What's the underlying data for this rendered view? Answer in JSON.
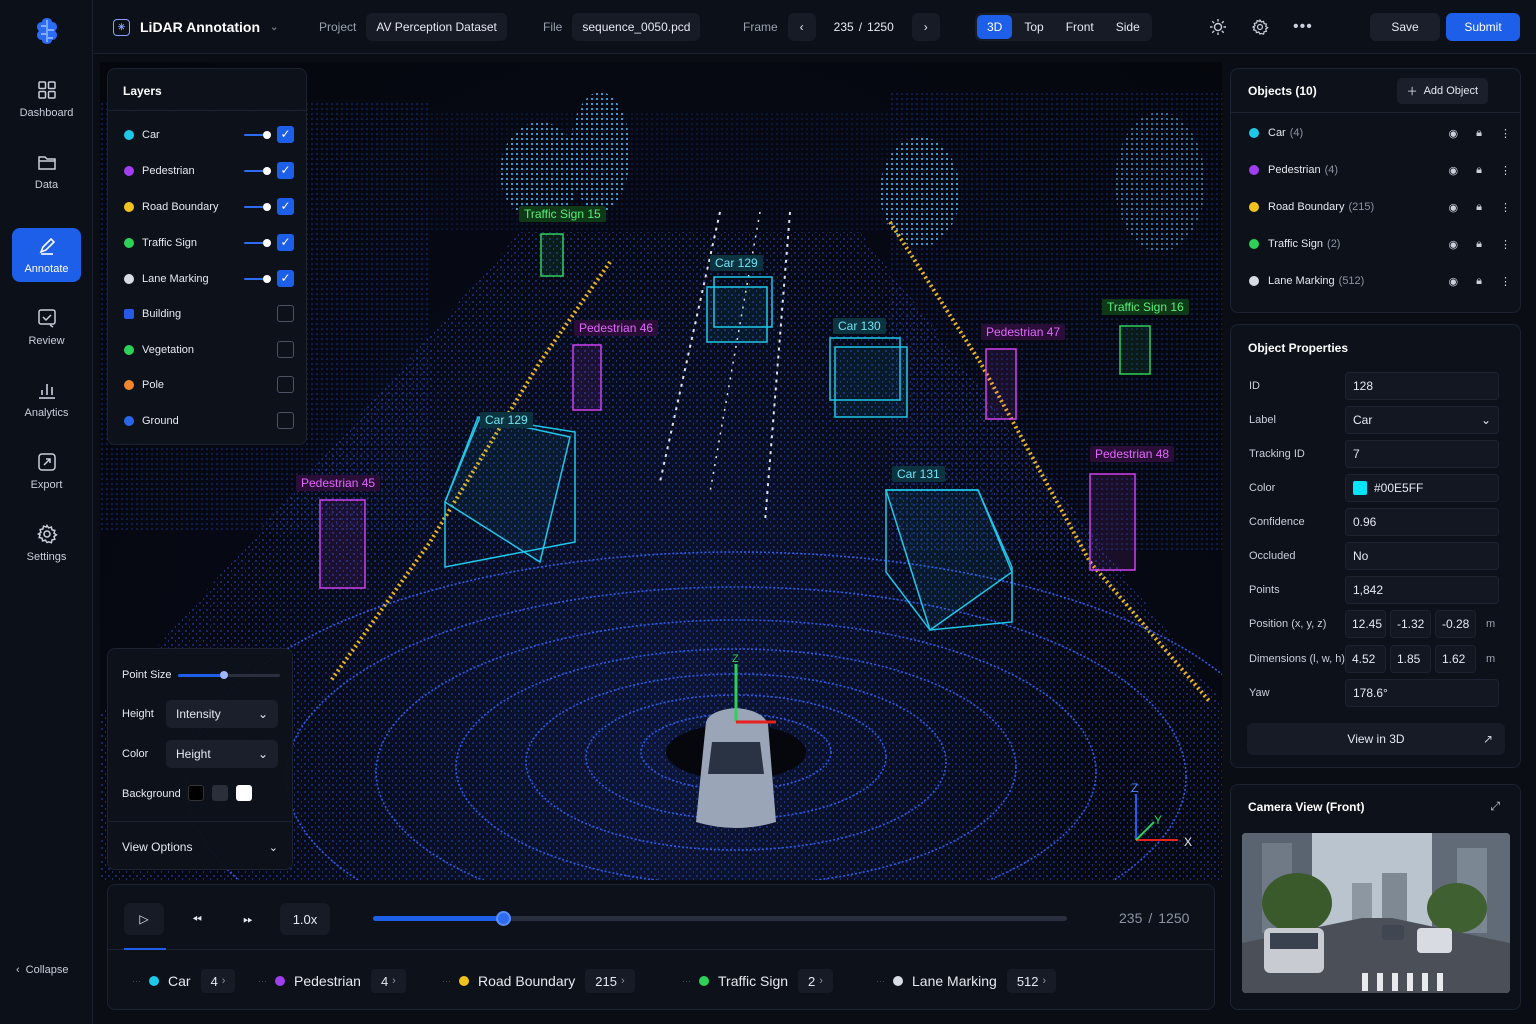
{
  "app": {
    "title": "LiDAR Annotation"
  },
  "nav": {
    "items": [
      {
        "label": "Dashboard",
        "icon": "grid-icon"
      },
      {
        "label": "Data",
        "icon": "folder-icon"
      },
      {
        "label": "Annotate",
        "icon": "pen-icon",
        "active": true
      },
      {
        "label": "Review",
        "icon": "review-icon"
      },
      {
        "label": "Analytics",
        "icon": "bar-chart-icon"
      },
      {
        "label": "Export",
        "icon": "export-icon"
      },
      {
        "label": "Settings",
        "icon": "gear-icon"
      }
    ],
    "collapse": "Collapse"
  },
  "topbar": {
    "project_label": "Project",
    "project_value": "AV Perception Dataset",
    "file_label": "File",
    "file_value": "sequence_0050.pcd",
    "frame_label": "Frame",
    "frame_current": "235",
    "frame_sep": "/",
    "frame_total": "1250",
    "views": [
      "3D",
      "Top",
      "Front",
      "Side"
    ],
    "active_view": "3D",
    "save": "Save",
    "submit": "Submit"
  },
  "layers": {
    "title": "Layers",
    "items": [
      {
        "name": "Car",
        "color": "#1ec8e8",
        "shape": "dot",
        "on": true
      },
      {
        "name": "Pedestrian",
        "color": "#a13ef0",
        "shape": "dot",
        "on": true
      },
      {
        "name": "Road Boundary",
        "color": "#f0c21e",
        "shape": "dot",
        "on": true
      },
      {
        "name": "Traffic Sign",
        "color": "#2ed158",
        "shape": "dot",
        "on": true
      },
      {
        "name": "Lane Marking",
        "color": "#d8dce4",
        "shape": "dot",
        "on": true
      },
      {
        "name": "Building",
        "color": "#2858e8",
        "shape": "square",
        "on": false
      },
      {
        "name": "Vegetation",
        "color": "#2ed158",
        "shape": "dot",
        "on": false
      },
      {
        "name": "Pole",
        "color": "#f0862e",
        "shape": "dot",
        "on": false
      },
      {
        "name": "Ground",
        "color": "#2868e8",
        "shape": "dot",
        "on": false
      }
    ]
  },
  "view_options": {
    "point_size_label": "Point Size",
    "point_size": 0.45,
    "height_label": "Height",
    "height_value": "Intensity",
    "color_label": "Color",
    "color_value": "Height",
    "background_label": "Background",
    "background_swatches": [
      "#000000",
      "#2a2f3a",
      "#ffffff"
    ],
    "view_options": "View Options"
  },
  "scene_labels": [
    {
      "text": "Traffic Sign 15",
      "color": "#2ed158"
    },
    {
      "text": "Car 129",
      "color": "#1ec8e8"
    },
    {
      "text": "Pedestrian 46",
      "color": "#d040f0"
    },
    {
      "text": "Car 130",
      "color": "#1ec8e8"
    },
    {
      "text": "Pedestrian 47",
      "color": "#d040f0"
    },
    {
      "text": "Traffic Sign 16",
      "color": "#2ed158"
    },
    {
      "text": "Car 129",
      "color": "#1ec8e8"
    },
    {
      "text": "Pedestrian 45",
      "color": "#d040f0"
    },
    {
      "text": "Car 131",
      "color": "#1ec8e8"
    },
    {
      "text": "Pedestrian 48",
      "color": "#d040f0"
    }
  ],
  "axes": {
    "z": "Z",
    "y": "Y",
    "x": "X"
  },
  "objects": {
    "title": "Objects (10)",
    "add": "Add Object",
    "items": [
      {
        "name": "Car",
        "count": "(4)",
        "color": "#1ec8e8"
      },
      {
        "name": "Pedestrian",
        "count": "(4)",
        "color": "#a13ef0"
      },
      {
        "name": "Road Boundary",
        "count": "(215)",
        "color": "#f0c21e"
      },
      {
        "name": "Traffic Sign",
        "count": "(2)",
        "color": "#2ed158"
      },
      {
        "name": "Lane Marking",
        "count": "(512)",
        "color": "#d8dce4"
      }
    ]
  },
  "properties": {
    "title": "Object Properties",
    "id_label": "ID",
    "id": "128",
    "label_label": "Label",
    "label": "Car",
    "tracking_label": "Tracking ID",
    "tracking": "7",
    "color_label": "Color",
    "color": "#00E5FF",
    "confidence_label": "Confidence",
    "confidence": "0.96",
    "occluded_label": "Occluded",
    "occluded": "No",
    "points_label": "Points",
    "points": "1,842",
    "position_label": "Position (x, y, z)",
    "position": [
      "12.45",
      "-1.32",
      "-0.28"
    ],
    "dimensions_label": "Dimensions (l, w, h)",
    "dimensions": [
      "4.52",
      "1.85",
      "1.62"
    ],
    "unit": "m",
    "yaw_label": "Yaw",
    "yaw": "178.6°",
    "view3d": "View in 3D"
  },
  "camera": {
    "title": "Camera View (Front)"
  },
  "timeline": {
    "speed": "1.0x",
    "progress": 0.188,
    "current": "235",
    "sep": "/",
    "total": "1250",
    "chips": [
      {
        "name": "Car",
        "count": "4",
        "color": "#1ec8e8"
      },
      {
        "name": "Pedestrian",
        "count": "4",
        "color": "#a13ef0"
      },
      {
        "name": "Road Boundary",
        "count": "215",
        "color": "#f0c21e"
      },
      {
        "name": "Traffic Sign",
        "count": "2",
        "color": "#2ed158"
      },
      {
        "name": "Lane Marking",
        "count": "512",
        "color": "#d8dce4"
      }
    ]
  }
}
